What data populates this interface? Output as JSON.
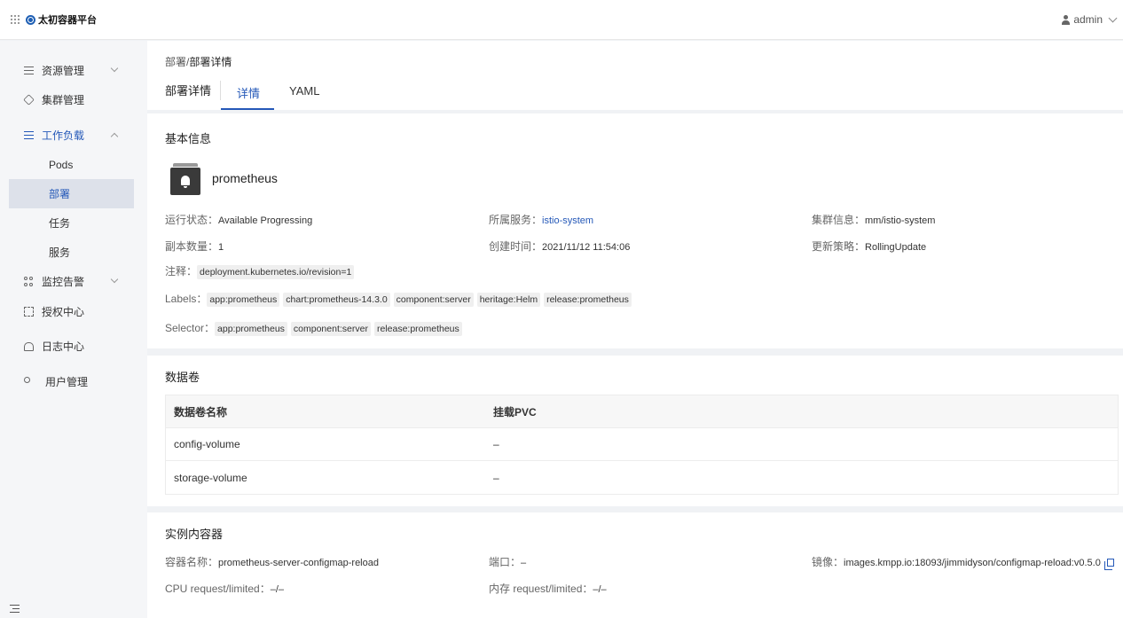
{
  "header": {
    "brand": "太初容器平台",
    "user": "admin"
  },
  "sidebar": {
    "items": [
      {
        "label": "资源管理"
      },
      {
        "label": "集群管理"
      },
      {
        "label": "工作负载"
      },
      {
        "label": "Pods"
      },
      {
        "label": "部署"
      },
      {
        "label": "任务"
      },
      {
        "label": "服务"
      },
      {
        "label": "监控告警"
      },
      {
        "label": "授权中心"
      },
      {
        "label": "日志中心"
      },
      {
        "label": "用户管理"
      }
    ]
  },
  "breadcrumb": {
    "parent": "部署",
    "sep": "/",
    "current": "部署详情"
  },
  "page": {
    "title": "部署详情"
  },
  "tabs": [
    {
      "label": "详情"
    },
    {
      "label": "YAML"
    }
  ],
  "basic": {
    "section_title": "基本信息",
    "name": "prometheus",
    "status_label": "运行状态：",
    "status_value": "Available  Progressing",
    "service_label": "所属服务：",
    "service_value": "istio-system",
    "cluster_label": "集群信息：",
    "cluster_value": "mm/istio-system",
    "replicas_label": "副本数量：",
    "replicas_value": "1",
    "created_label": "创建时间：",
    "created_value": "2021/11/12 11:54:06",
    "strategy_label": "更新策略：",
    "strategy_value": "RollingUpdate",
    "annotation_label": "注释：",
    "annotation_value": "deployment.kubernetes.io/revision=1",
    "labels_label": "Labels：",
    "labels": [
      "app:prometheus",
      "chart:prometheus-14.3.0",
      "component:server",
      "heritage:Helm",
      "release:prometheus"
    ],
    "selector_label": "Selector：",
    "selector": [
      "app:prometheus",
      "component:server",
      "release:prometheus"
    ]
  },
  "volumes": {
    "section_title": "数据卷",
    "columns": [
      "数据卷名称",
      "挂载PVC"
    ],
    "rows": [
      {
        "name": "config-volume",
        "pvc": "–"
      },
      {
        "name": "storage-volume",
        "pvc": "–"
      }
    ]
  },
  "container": {
    "section_title": "实例内容器",
    "name_label": "容器名称：",
    "name_value": "prometheus-server-configmap-reload",
    "port_label": "端口：",
    "port_value": "–",
    "image_label": "镜像：",
    "image_value": "images.kmpp.io:18093/jimmidyson/configmap-reload:v0.5.0",
    "cpu_label": "CPU request/limited：",
    "cpu_value": "–/–",
    "mem_label": "内存 request/limited：",
    "mem_value": "–/–"
  }
}
